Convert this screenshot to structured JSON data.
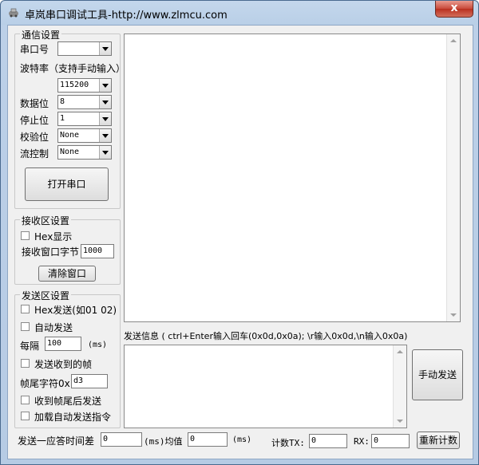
{
  "window": {
    "title": "卓岚串口调试工具-http://www.zlmcu.com",
    "close_label": "x"
  },
  "comm": {
    "legend": "通信设置",
    "port_label": "串口号",
    "port_value": "",
    "baud_label": "波特率（支持手动输入）",
    "baud_value": "115200",
    "databits_label": "数据位",
    "databits_value": "8",
    "stopbits_label": "停止位",
    "stopbits_value": "1",
    "parity_label": "校验位",
    "parity_value": "None",
    "flow_label": "流控制",
    "flow_value": "None",
    "open_button": "打开串口"
  },
  "recv": {
    "legend": "接收区设置",
    "hex_label": "Hex显示",
    "bytes_label": "接收窗口字节",
    "bytes_value": "1000",
    "clear_button": "清除窗口"
  },
  "send": {
    "legend": "发送区设置",
    "hex_label": "Hex发送(如01 02)",
    "auto_label": "自动发送",
    "interval_label": "每隔",
    "interval_value": "100",
    "interval_unit": "(ms)",
    "send_received_label": "发送收到的帧",
    "tail_label": "帧尾字符0x",
    "tail_value": "d3",
    "after_tail_label": "收到帧尾后发送",
    "load_cmd_label": "加载自动发送指令"
  },
  "main": {
    "send_info": "发送信息 ( ctrl+Enter输入回车(0x0d,0x0a); \\r输入0x0d,\\n输入0x0a)",
    "manual_send_button": "手动发送"
  },
  "status": {
    "response_label": "发送一应答时间差",
    "response_value": "0",
    "ms_avg": "(ms)均值",
    "avg_value": "0",
    "ms": "(ms)",
    "tx_label": "计数TX:",
    "tx_value": "0",
    "rx_label": "RX:",
    "rx_value": "0",
    "reset_button": "重新计数"
  }
}
